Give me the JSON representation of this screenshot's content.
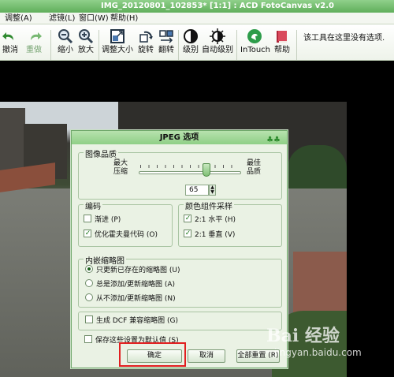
{
  "window": {
    "title": "IMG_20120801_102853* [1:1] : ACD FotoCanvas v2.0"
  },
  "menu": {
    "items": [
      "调整(A)",
      "滤镜(L)",
      "窗口(W)",
      "帮助(H)"
    ]
  },
  "toolbar": {
    "items": [
      {
        "label": "撤消",
        "icon": "undo-icon"
      },
      {
        "label": "重做",
        "icon": "redo-icon"
      },
      {
        "label": "缩小",
        "icon": "zoom-out-icon"
      },
      {
        "label": "放大",
        "icon": "zoom-in-icon"
      },
      {
        "label": "调整大小",
        "icon": "resize-icon"
      },
      {
        "label": "旋转",
        "icon": "rotate-icon"
      },
      {
        "label": "翻转",
        "icon": "flip-icon"
      },
      {
        "label": "级别",
        "icon": "levels-icon"
      },
      {
        "label": "自动级别",
        "icon": "auto-levels-icon"
      },
      {
        "label": "InTouch",
        "icon": "intouch-icon"
      },
      {
        "label": "帮助",
        "icon": "help-book-icon"
      }
    ],
    "hint": "该工具在这里没有选项."
  },
  "dialog": {
    "title": "JPEG 选项",
    "quality": {
      "legend": "图像品质",
      "left_label_1": "最大",
      "left_label_2": "压缩",
      "right_label_1": "最佳",
      "right_label_2": "品质",
      "value": "65",
      "slider_fraction": 0.65
    },
    "encoding": {
      "legend": "编码",
      "progressive": {
        "label": "渐进 (P)",
        "checked": false
      },
      "huffman": {
        "label": "优化霍夫曼代码 (O)",
        "checked": true
      }
    },
    "chroma": {
      "legend": "颜色组件采样",
      "horizontal": {
        "label": "2:1 水平 (H)",
        "checked": true
      },
      "vertical": {
        "label": "2:1 垂直 (V)",
        "checked": true
      }
    },
    "thumbnail": {
      "legend": "内嵌缩略图",
      "options": [
        {
          "label": "只更新已存在的缩略图 (U)",
          "selected": true
        },
        {
          "label": "总是添加/更新缩略图 (A)",
          "selected": false
        },
        {
          "label": "从不添加/更新缩略图 (N)",
          "selected": false
        }
      ]
    },
    "dcf": {
      "label": "生成 DCF 兼容缩略图 (G)",
      "checked": false
    },
    "save_default": {
      "label": "保存这些设置为默认值 (S)",
      "checked": false
    },
    "buttons": {
      "ok": "确定",
      "cancel": "取消",
      "reset": "全部重置 (R)"
    }
  },
  "watermark": {
    "text": "Bai 经验",
    "sub": "jingyan.baidu.com"
  },
  "colors": {
    "title_bar": "#5fae5a",
    "dialog_bg": "#eaf2e4",
    "highlight": "#e11f1f"
  }
}
